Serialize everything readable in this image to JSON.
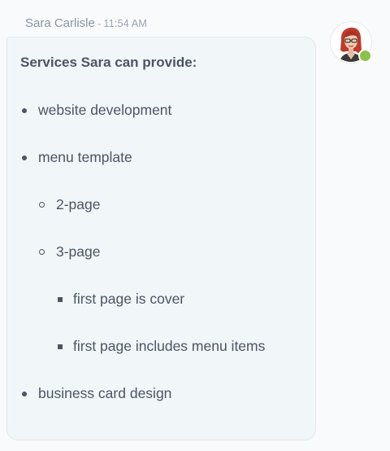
{
  "message": {
    "sender": "Sara Carlisle",
    "separator": " - ",
    "time": "11:54 AM",
    "heading": "Services Sara can provide:",
    "items": [
      {
        "label": "website development"
      },
      {
        "label": "menu template"
      },
      {
        "label": "2-page"
      },
      {
        "label": "3-page"
      },
      {
        "label": "first page is cover"
      },
      {
        "label": "first page includes menu items"
      },
      {
        "label": "business card design"
      }
    ]
  },
  "icons": {
    "avatar": "user-avatar-icon",
    "presence": "online-status-icon"
  },
  "colors": {
    "bubble_background": "#f1f6f9",
    "text": "#4b5563",
    "meta_text": "#8a94a3",
    "presence_online": "#8bc34a"
  }
}
